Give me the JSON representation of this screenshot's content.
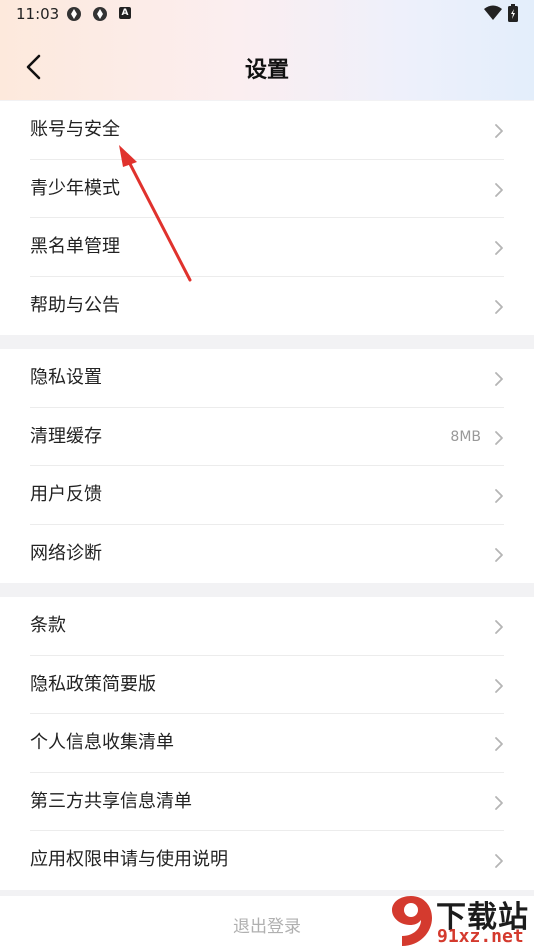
{
  "status_bar": {
    "time": "11:03",
    "icons": [
      "sync-icon",
      "sync-icon",
      "android-icon"
    ],
    "right_icons": [
      "wifi-icon",
      "battery-icon"
    ],
    "app_badge": "A"
  },
  "header": {
    "title": "设置",
    "back_icon": "chevron-left-icon"
  },
  "groups": [
    {
      "items": [
        {
          "label": "账号与安全"
        },
        {
          "label": "青少年模式"
        },
        {
          "label": "黑名单管理"
        },
        {
          "label": "帮助与公告"
        }
      ]
    },
    {
      "items": [
        {
          "label": "隐私设置"
        },
        {
          "label": "清理缓存",
          "value": "8MB"
        },
        {
          "label": "用户反馈"
        },
        {
          "label": "网络诊断"
        }
      ]
    },
    {
      "items": [
        {
          "label": "条款"
        },
        {
          "label": "隐私政策简要版"
        },
        {
          "label": "个人信息收集清单"
        },
        {
          "label": "第三方共享信息清单"
        },
        {
          "label": "应用权限申请与使用说明"
        }
      ]
    }
  ],
  "logout": {
    "label": "退出登录"
  },
  "watermark": {
    "big": "下载站",
    "small": "91xz.net",
    "logo_text": "9"
  },
  "colors": {
    "accent_arrow": "#e0322d",
    "chevron": "#b5b5b5",
    "background": "#f2f2f4"
  }
}
